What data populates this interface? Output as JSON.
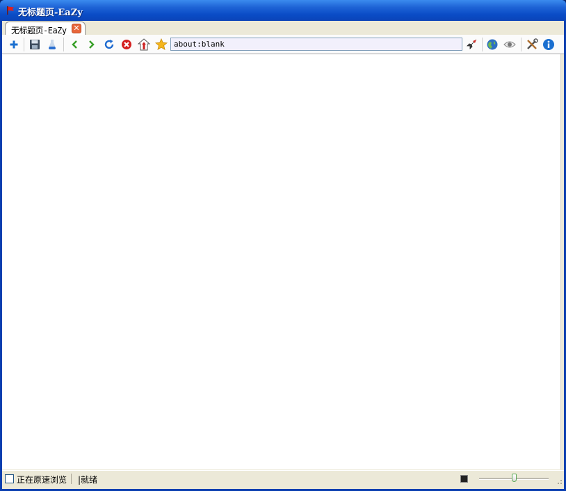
{
  "window": {
    "title": "无标题页-EaZy"
  },
  "tabs": [
    {
      "label": "无标题页-EaZy"
    }
  ],
  "toolbar": {
    "address_value": "about:blank"
  },
  "statusbar": {
    "checkbox_label": "正在原速浏览",
    "status_text": "|就绪",
    "zoom_level": 0.5
  },
  "colors": {
    "titlebar": "#1e63d6",
    "accent": "#0a3fb0",
    "tab_close": "#e8663a"
  }
}
